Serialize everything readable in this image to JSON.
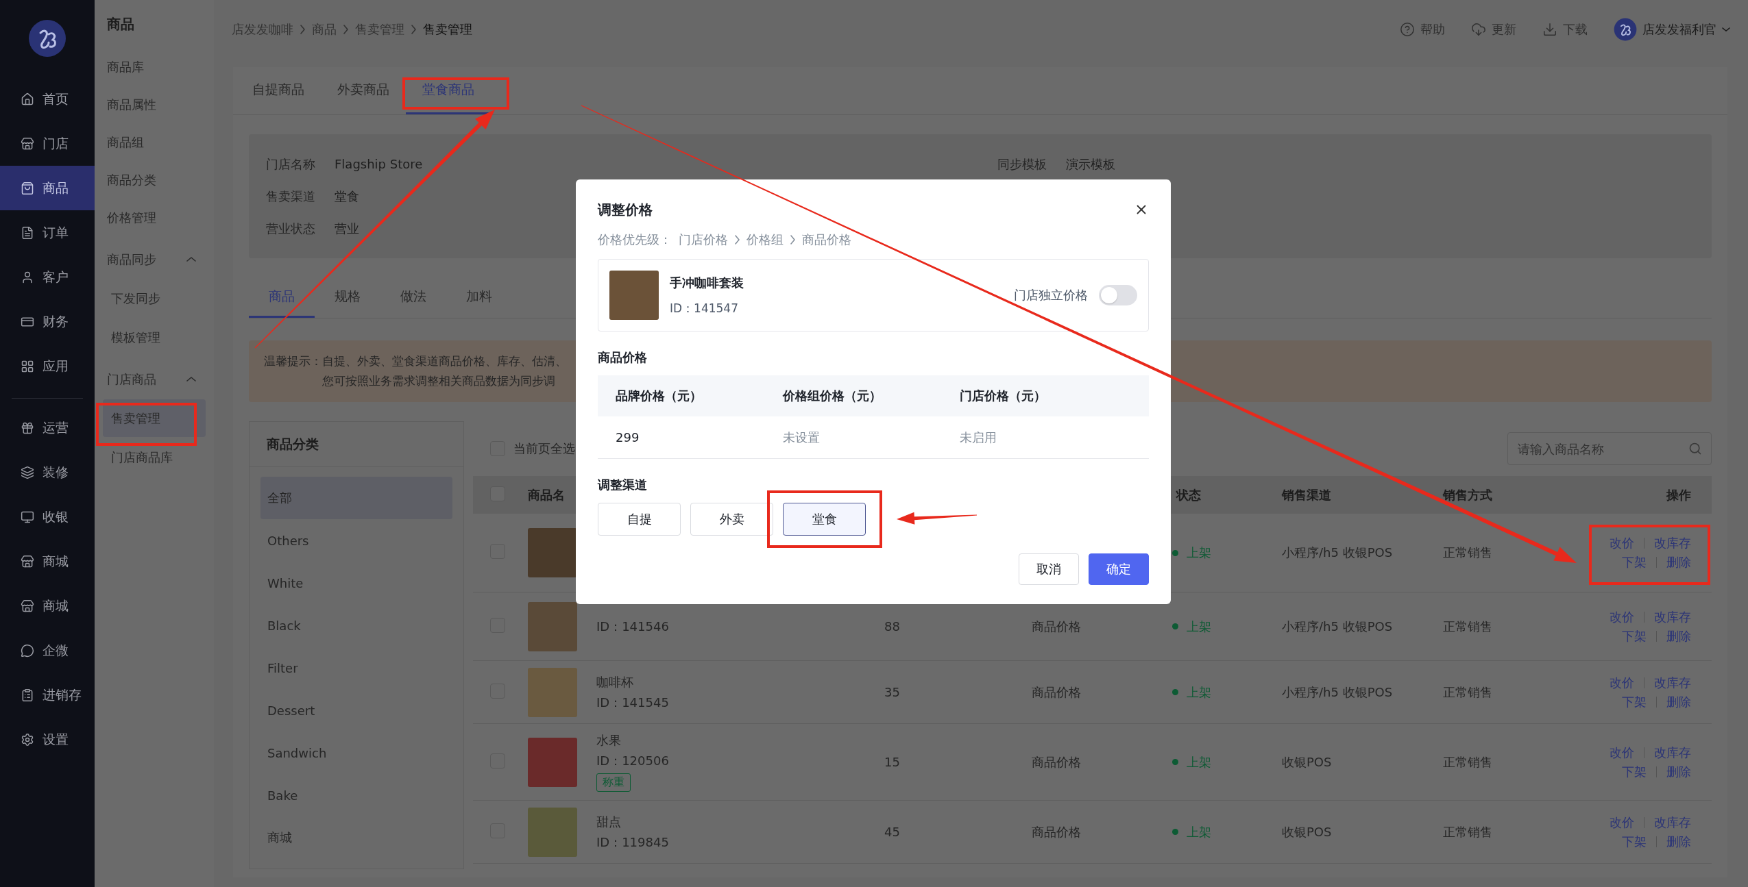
{
  "sidebar": {
    "primary": [
      {
        "label": "首页",
        "selected": false
      },
      {
        "label": "门店",
        "selected": false
      },
      {
        "label": "商品",
        "selected": true
      },
      {
        "label": "订单",
        "selected": false
      },
      {
        "label": "客户",
        "selected": false
      },
      {
        "label": "财务",
        "selected": false
      },
      {
        "label": "应用",
        "selected": false
      }
    ],
    "secondary": [
      {
        "label": "运营",
        "selected": false
      },
      {
        "label": "装修",
        "selected": false
      },
      {
        "label": "收银",
        "selected": false
      },
      {
        "label": "商城",
        "selected": false
      },
      {
        "label": "商城",
        "selected": false
      },
      {
        "label": "企微",
        "selected": false
      },
      {
        "label": "进销存",
        "selected": false
      },
      {
        "label": "设置",
        "selected": false
      }
    ]
  },
  "submenu": {
    "title": "商品",
    "items": [
      {
        "label": "商品库",
        "selected": false
      },
      {
        "label": "商品属性",
        "selected": false
      },
      {
        "label": "商品组",
        "selected": false
      },
      {
        "label": "商品分类",
        "selected": false
      },
      {
        "label": "价格管理",
        "selected": false
      },
      {
        "label": "商品同步",
        "selected": false,
        "expanded": true,
        "children": [
          {
            "label": "下发同步",
            "selected": false
          },
          {
            "label": "模板管理",
            "selected": false
          }
        ]
      },
      {
        "label": "门店商品",
        "selected": false,
        "expanded": true,
        "children": [
          {
            "label": "售卖管理",
            "selected": true
          },
          {
            "label": "门店商品库",
            "selected": false
          }
        ]
      }
    ]
  },
  "header": {
    "breadcrumbs": [
      "店发发咖啡",
      "商品",
      "售卖管理",
      "售卖管理"
    ],
    "actions": [
      "帮助",
      "更新",
      "下载"
    ],
    "user": "店发发福利官"
  },
  "channel_tabs": [
    {
      "label": "自提商品",
      "selected": false
    },
    {
      "label": "外卖商品",
      "selected": false
    },
    {
      "label": "堂食商品",
      "selected": true
    }
  ],
  "store_info": {
    "fields": [
      {
        "label": "门店名称",
        "value": "Flagship Store"
      },
      {
        "label": "售卖渠道",
        "value": "堂食"
      },
      {
        "label": "营业状态",
        "value": "营业"
      }
    ],
    "template": {
      "label": "同步模板",
      "value": "演示模板"
    }
  },
  "sub_tabs": [
    {
      "label": "商品",
      "selected": true
    },
    {
      "label": "规格",
      "selected": false
    },
    {
      "label": "做法",
      "selected": false
    },
    {
      "label": "加料",
      "selected": false
    }
  ],
  "notice": {
    "label": "温馨提示：",
    "lines": [
      "自提、外卖、堂食渠道商品价格、库存、估清、",
      "您可按照业务需求调整相关商品数据为同步调"
    ]
  },
  "categories": {
    "title": "商品分类",
    "items": [
      {
        "label": "全部",
        "selected": true
      },
      {
        "label": "Others",
        "selected": false
      },
      {
        "label": "White",
        "selected": false
      },
      {
        "label": "Black",
        "selected": false
      },
      {
        "label": "Filter",
        "selected": false
      },
      {
        "label": "Dessert",
        "selected": false
      },
      {
        "label": "Sandwich",
        "selected": false
      },
      {
        "label": "Bake",
        "selected": false
      },
      {
        "label": "商城",
        "selected": false
      }
    ]
  },
  "product_list": {
    "select_all": {
      "label": "当前页全选",
      "checked": false
    },
    "search": {
      "placeholder": "请输入商品名称"
    },
    "header_checked": false,
    "columns": {
      "product": "商品名",
      "status": "状态",
      "channel": "销售渠道",
      "method": "销售方式",
      "actions": "操作"
    },
    "rows": [
      {
        "checked": false,
        "status": "上架",
        "channel": "小程序/h5 收银POS",
        "method": "正常销售",
        "actions": [
          "改价",
          "改库存",
          "下架",
          "删除"
        ]
      },
      {
        "checked": false,
        "id": "ID：141546",
        "price": "88",
        "price_source": "商品价格",
        "status": "上架",
        "channel": "小程序/h5 收银POS",
        "method": "正常销售",
        "actions": [
          "改价",
          "改库存",
          "下架",
          "删除"
        ]
      },
      {
        "checked": false,
        "name": "咖啡杯",
        "id": "ID：141545",
        "price": "35",
        "price_source": "商品价格",
        "status": "上架",
        "channel": "小程序/h5 收银POS",
        "method": "正常销售",
        "actions": [
          "改价",
          "改库存",
          "下架",
          "删除"
        ]
      },
      {
        "checked": false,
        "name": "水果",
        "id": "ID：120506",
        "tag": "称重",
        "price": "15",
        "price_source": "商品价格",
        "status": "上架",
        "channel": "收银POS",
        "method": "正常销售",
        "actions": [
          "改价",
          "改库存",
          "下架",
          "删除"
        ]
      },
      {
        "checked": false,
        "name": "甜点",
        "id": "ID：119845",
        "price": "45",
        "price_source": "商品价格",
        "status": "上架",
        "channel": "收银POS",
        "method": "正常销售",
        "actions": [
          "改价",
          "改库存",
          "下架",
          "删除"
        ]
      }
    ]
  },
  "dialog": {
    "title": "调整价格",
    "priority": {
      "label": "价格优先级：",
      "steps": [
        "门店价格",
        "价格组",
        "商品价格"
      ]
    },
    "product": {
      "name": "手冲咖啡套装",
      "id": "ID：141547"
    },
    "independent_price": {
      "label": "门店独立价格",
      "on": false
    },
    "price_section": "商品价格",
    "price_table": {
      "columns": [
        "品牌价格（元）",
        "价格组价格（元）",
        "门店价格（元）"
      ],
      "cells": [
        {
          "text": "299",
          "muted": false
        },
        {
          "text": "未设置",
          "muted": true
        },
        {
          "text": "未启用",
          "muted": true
        }
      ]
    },
    "channel_section": "调整渠道",
    "channels": [
      {
        "label": "自提",
        "selected": false
      },
      {
        "label": "外卖",
        "selected": false
      },
      {
        "label": "堂食",
        "selected": true
      }
    ],
    "buttons": [
      {
        "label": "取消",
        "kind": "secondary"
      },
      {
        "label": "确定",
        "kind": "primary"
      }
    ]
  }
}
